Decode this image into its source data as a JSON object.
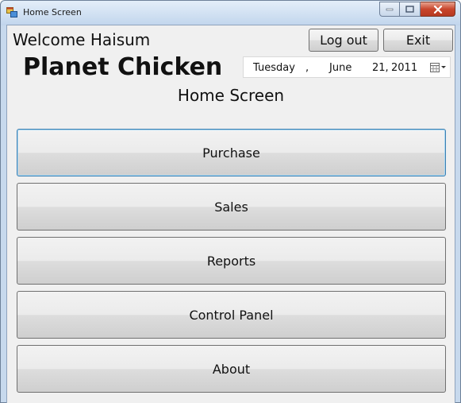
{
  "window": {
    "title": "Home Screen",
    "icon": "app-window-icon",
    "accent_close": "#c8452c"
  },
  "header": {
    "welcome": "Welcome Haisum",
    "brand": "Planet Chicken",
    "screen_title": "Home Screen",
    "logout_label": "Log out",
    "exit_label": "Exit"
  },
  "date_picker": {
    "day": "Tuesday",
    "separator": ",",
    "month": "June",
    "date": "21,",
    "year": "2011",
    "icon": "calendar-dropdown-icon"
  },
  "menu": {
    "buttons": [
      {
        "label": "Purchase",
        "focused": true
      },
      {
        "label": "Sales"
      },
      {
        "label": "Reports"
      },
      {
        "label": "Control Panel"
      },
      {
        "label": "About"
      }
    ]
  }
}
